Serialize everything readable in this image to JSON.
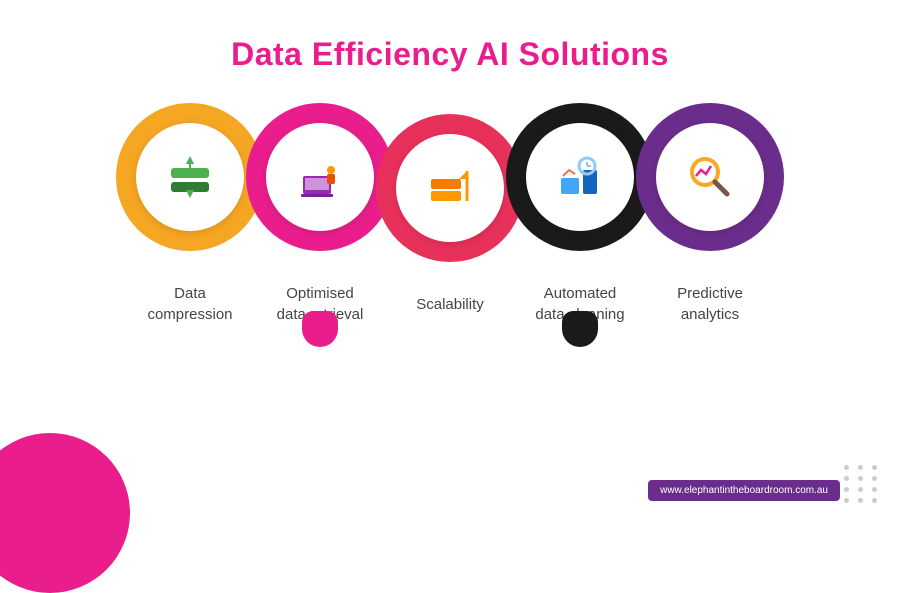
{
  "page": {
    "title": "Data Efficiency AI Solutions",
    "background_color": "#ffffff"
  },
  "circles": [
    {
      "id": "data-compression",
      "color_class": "circle-yellow",
      "color_hex": "#F5A623",
      "icon": "🗜️",
      "label": "Data\ncompression",
      "label_display": "Data\ncompression"
    },
    {
      "id": "optimised-retrieval",
      "color_class": "circle-pink",
      "color_hex": "#E91E8C",
      "icon": "📂",
      "label": "Optimised\ndata retrieval",
      "label_display": "Optimised\ndata retrieval",
      "has_drip": true,
      "drip_class": "circle-pink-drip"
    },
    {
      "id": "scalability",
      "color_class": "circle-red",
      "color_hex": "#E8315A",
      "icon": "📊",
      "label": "Scalability",
      "label_display": "Scalability"
    },
    {
      "id": "automated-cleaning",
      "color_class": "circle-black",
      "color_hex": "#1a1a1a",
      "icon": "⚙️",
      "label": "Automated\ndata cleaning",
      "label_display": "Automated\ndata cleaning",
      "has_drip": true,
      "drip_class": "circle-black-drip"
    },
    {
      "id": "predictive-analytics",
      "color_class": "circle-purple",
      "color_hex": "#6B2D8B",
      "icon": "🔍",
      "label": "Predictive\nanalytics",
      "label_display": "Predictive\nanalytics"
    }
  ],
  "footer": {
    "website": "www.elephantintheboardroom.com.au"
  },
  "decorative": {
    "dots_count": 12
  }
}
